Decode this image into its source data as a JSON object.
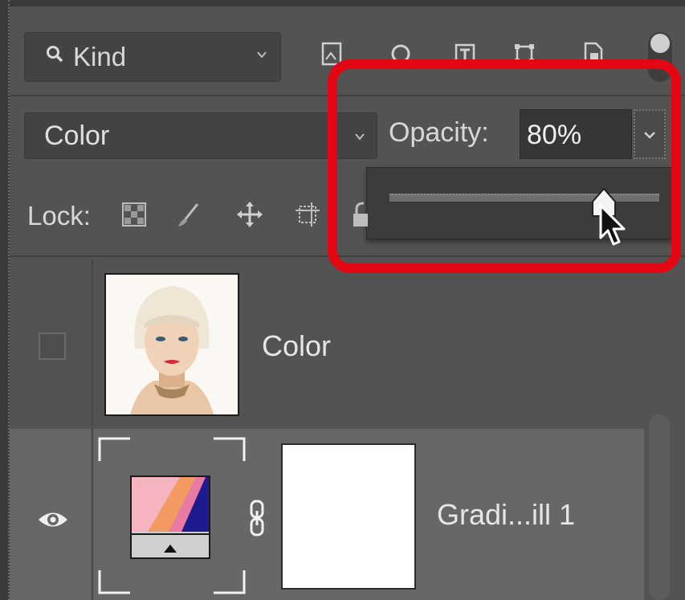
{
  "filter": {
    "label": "Kind"
  },
  "blend_mode": {
    "value": "Color"
  },
  "opacity": {
    "label": "Opacity:",
    "value": "80%",
    "level_percent": 80
  },
  "lock": {
    "label": "Lock:"
  },
  "layers": [
    {
      "name": "Color",
      "visible": false,
      "thumbnail": "portrait-photo"
    },
    {
      "name": "Gradi...ill 1",
      "visible": true,
      "thumbnail": "gradient-fill-icon",
      "has_mask": true,
      "selected": true
    }
  ],
  "colors": {
    "highlight": "#e30613",
    "panel_bg": "#535353",
    "selected_row": "#676767"
  }
}
